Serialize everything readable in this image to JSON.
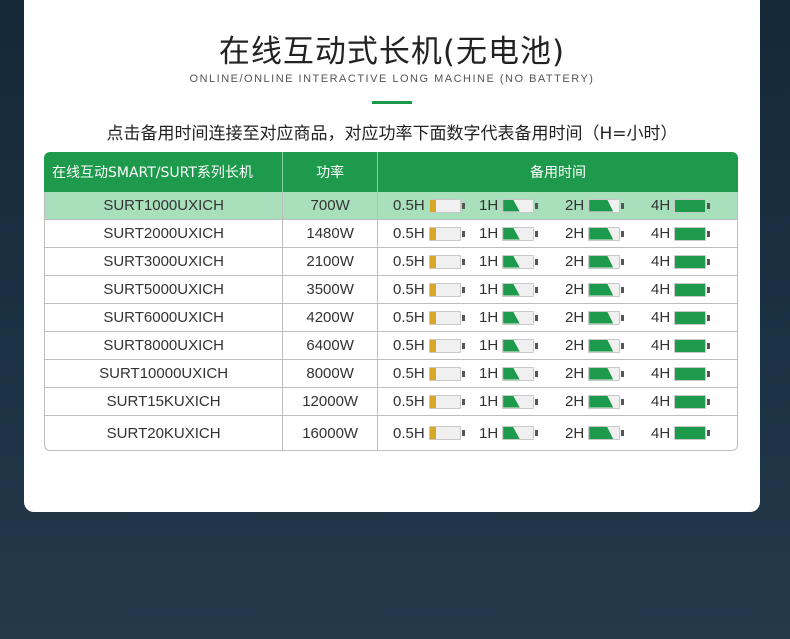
{
  "header": {
    "title": "在线互动式长机(无电池)",
    "subtitle": "ONLINE/ONLINE INTERACTIVE LONG MACHINE (NO BATTERY)",
    "note": "点击备用时间连接至对应商品，对应功率下面数字代表备用时间（H=小时）"
  },
  "table": {
    "headers": [
      "在线互动SMART/SURT系列长机",
      "功率",
      "备用时间"
    ],
    "time_labels": [
      "0.5H",
      "1H",
      "2H",
      "4H"
    ],
    "battery_levels": [
      0.2,
      0.5,
      0.75,
      1.0
    ],
    "colors": {
      "header_green": "#1e9a4c",
      "highlight": "#a8e0bc",
      "half_hour_battery": "#d6a826"
    },
    "rows": [
      {
        "model": "SURT1000UXICH",
        "power": "700W"
      },
      {
        "model": "SURT2000UXICH",
        "power": "1480W"
      },
      {
        "model": "SURT3000UXICH",
        "power": "2100W"
      },
      {
        "model": "SURT5000UXICH",
        "power": "3500W"
      },
      {
        "model": "SURT6000UXICH",
        "power": "4200W"
      },
      {
        "model": "SURT8000UXICH",
        "power": "6400W"
      },
      {
        "model": "SURT10000UXICH",
        "power": "8000W"
      },
      {
        "model": "SURT15KUXICH",
        "power": "12000W"
      },
      {
        "model": "SURT20KUXICH",
        "power": "16000W"
      }
    ]
  }
}
